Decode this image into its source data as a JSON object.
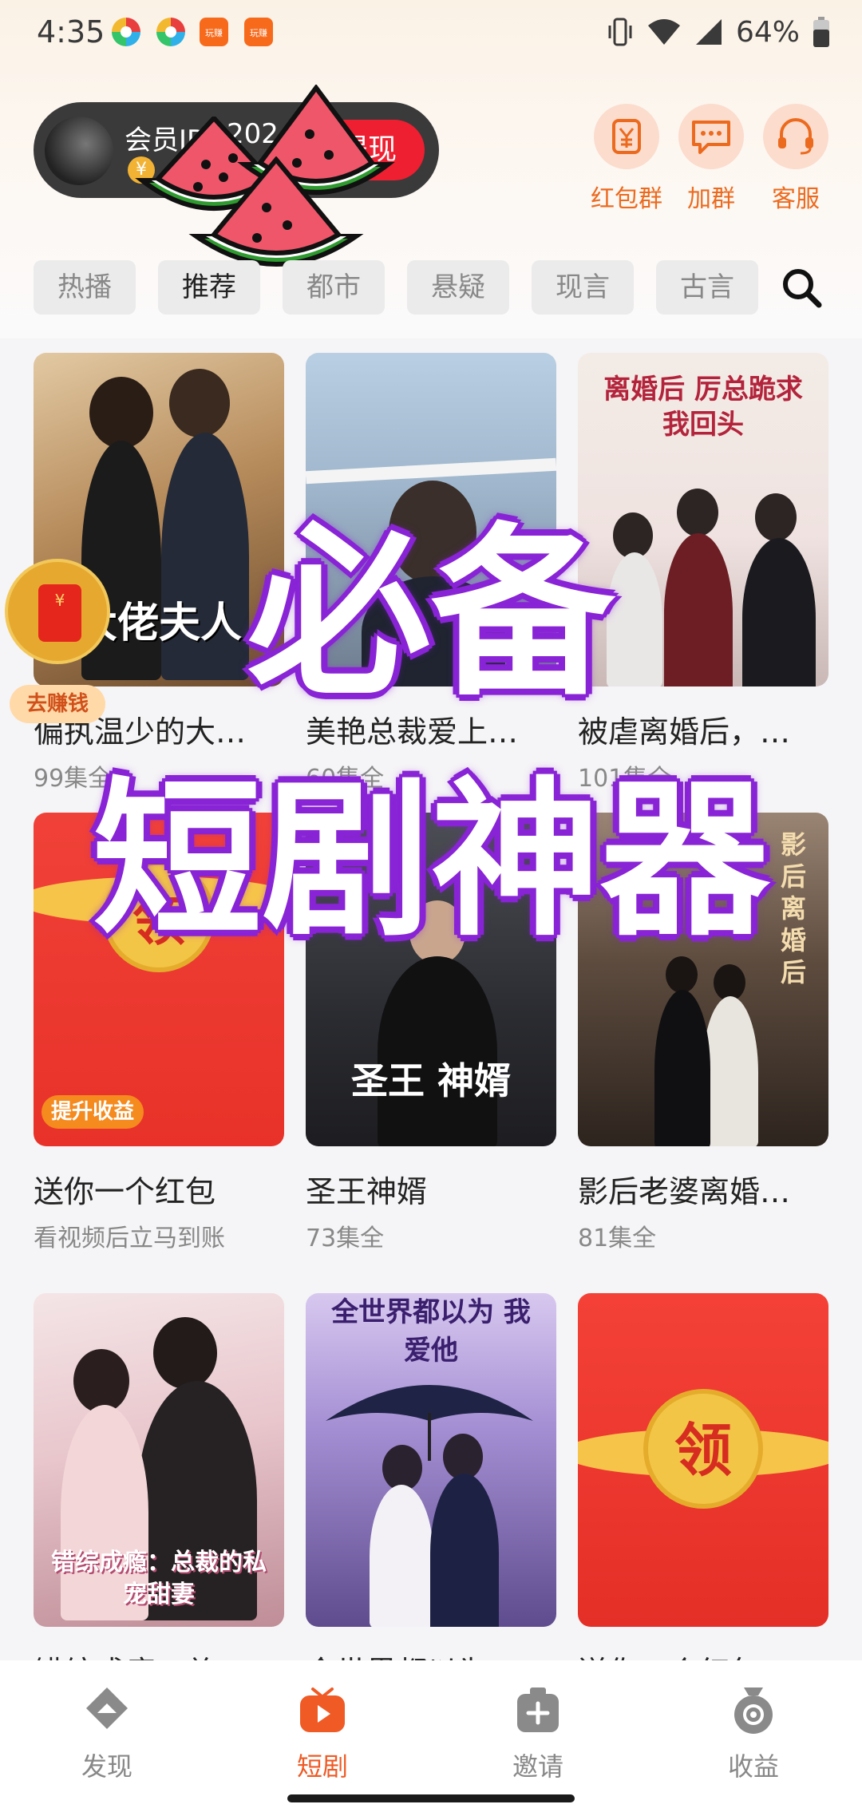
{
  "status_bar": {
    "time": "4:35",
    "battery": "64%"
  },
  "header": {
    "member_label": "会员ID:",
    "member_id": "202",
    "withdraw_label": "提现",
    "coin_symbol": "¥"
  },
  "quick_actions": [
    {
      "label": "红包群",
      "icon": "yuan-cup-icon"
    },
    {
      "label": "加群",
      "icon": "chat-bubble-icon"
    },
    {
      "label": "客服",
      "icon": "headset-icon"
    }
  ],
  "category_tabs": [
    "热播",
    "推荐",
    "都市",
    "悬疑",
    "现言",
    "古言"
  ],
  "selected_category": "推荐",
  "cards": [
    {
      "title": "偏执温少的大…",
      "subtitle": "99集全",
      "poster_text": "大佬夫人"
    },
    {
      "title": "美艳总裁爱上…",
      "subtitle": "60集全"
    },
    {
      "title": "被虐离婚后，…",
      "subtitle": "101集全",
      "poster_text": "离婚后 厉总跪求我回头"
    },
    {
      "title": "送你一个红包",
      "subtitle": "看视频后立马到账",
      "envelope_text": "领",
      "badge": "提升收益"
    },
    {
      "title": "圣王神婿",
      "subtitle": "73集全",
      "poster_text": "圣王 神婿"
    },
    {
      "title": "影后老婆离婚…",
      "subtitle": "81集全",
      "poster_text": "影后 离婚后"
    },
    {
      "title": "错综成瘾：总…",
      "subtitle": "",
      "poster_text": "错综成瘾：总裁的私宠甜妻"
    },
    {
      "title": "全世界都以为…",
      "subtitle": "",
      "poster_text": "全世界都以为 我爱他"
    },
    {
      "title": "送你一个红包",
      "subtitle": "",
      "envelope_text": "领"
    }
  ],
  "floating": {
    "earn_label": "去赚钱"
  },
  "overlay": {
    "line1": "必备",
    "line2": "短剧神器"
  },
  "bottom_tabs": [
    {
      "label": "发现",
      "icon": "discover-icon"
    },
    {
      "label": "短剧",
      "icon": "play-tv-icon"
    },
    {
      "label": "邀请",
      "icon": "invite-plus-icon"
    },
    {
      "label": "收益",
      "icon": "coin-pot-icon"
    }
  ],
  "active_tab": "短剧",
  "colors": {
    "accent": "#ef5a25",
    "red": "#ee1f30",
    "overlay_purple": "#8a25d6"
  }
}
